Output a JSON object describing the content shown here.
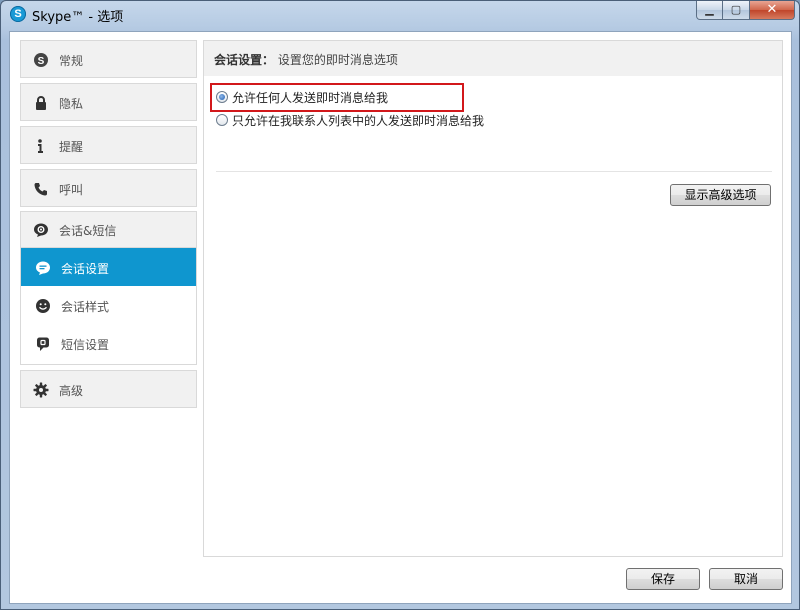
{
  "window": {
    "title": "Skype™ - 选项",
    "app_icon_letter": "S",
    "minimize_glyph": "▁",
    "maximize_glyph": "▢",
    "close_glyph": "✕"
  },
  "sidebar": {
    "items": [
      {
        "label": "常规",
        "icon": "skype-icon"
      },
      {
        "label": "隐私",
        "icon": "lock-icon"
      },
      {
        "label": "提醒",
        "icon": "info-icon"
      },
      {
        "label": "呼叫",
        "icon": "phone-icon"
      }
    ],
    "group": {
      "label": "会话&短信",
      "icon": "chat-gear-icon",
      "sub_items": [
        {
          "label": "会话设置",
          "icon": "chat-bubble-icon",
          "active": true
        },
        {
          "label": "会话样式",
          "icon": "smiley-icon",
          "active": false
        },
        {
          "label": "短信设置",
          "icon": "sms-icon",
          "active": false
        }
      ]
    },
    "advanced": {
      "label": "高级",
      "icon": "gear-icon"
    }
  },
  "panel": {
    "header_strong": "会话设置：",
    "header_text": "设置您的即时消息选项",
    "options": [
      {
        "label": "允许任何人发送即时消息给我",
        "checked": true
      },
      {
        "label": "只允许在我联系人列表中的人发送即时消息给我",
        "checked": false
      }
    ],
    "advanced_button": "显示高级选项"
  },
  "footer": {
    "save_label": "保存",
    "cancel_label": "取消"
  },
  "colors": {
    "active_item": "#0f96cf",
    "highlight_border": "#d2181b"
  }
}
